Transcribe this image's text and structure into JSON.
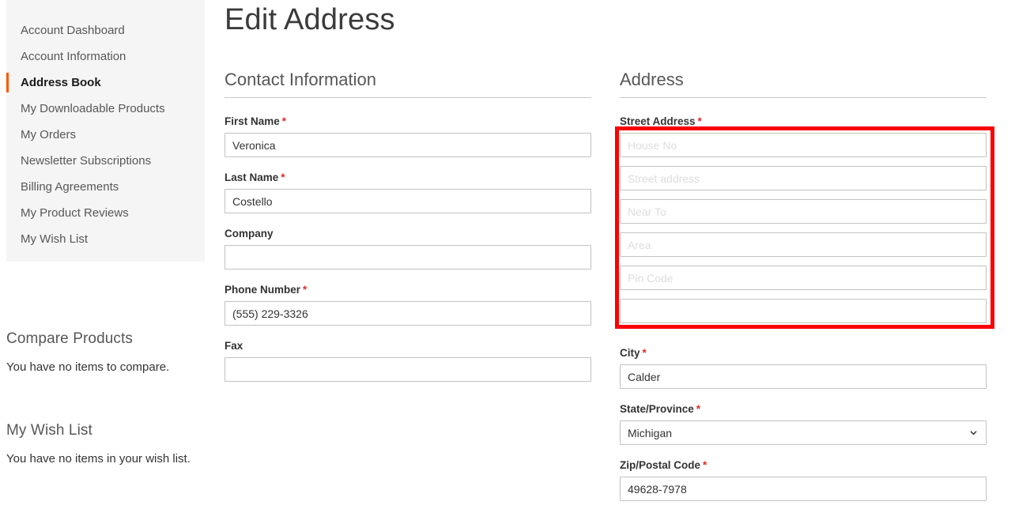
{
  "page": {
    "title": "Edit Address"
  },
  "sidebar": {
    "items": [
      {
        "label": "Account Dashboard",
        "active": false
      },
      {
        "label": "Account Information",
        "active": false
      },
      {
        "label": "Address Book",
        "active": true
      },
      {
        "label": "My Downloadable Products",
        "active": false
      },
      {
        "label": "My Orders",
        "active": false
      },
      {
        "label": "Newsletter Subscriptions",
        "active": false
      },
      {
        "label": "Billing Agreements",
        "active": false
      },
      {
        "label": "My Product Reviews",
        "active": false
      },
      {
        "label": "My Wish List",
        "active": false
      }
    ],
    "compare_block": {
      "title": "Compare Products",
      "empty_text": "You have no items to compare."
    },
    "wishlist_block": {
      "title": "My Wish List",
      "empty_text": "You have no items in your wish list."
    }
  },
  "contact_section": {
    "legend": "Contact Information",
    "fields": {
      "first_name": {
        "label": "First Name",
        "required_mark": "*",
        "value": "Veronica",
        "placeholder": ""
      },
      "last_name": {
        "label": "Last Name",
        "required_mark": "*",
        "value": "Costello",
        "placeholder": ""
      },
      "company": {
        "label": "Company",
        "required_mark": "",
        "value": "",
        "placeholder": ""
      },
      "phone": {
        "label": "Phone Number",
        "required_mark": "*",
        "value": "(555) 229-3326",
        "placeholder": ""
      },
      "fax": {
        "label": "Fax",
        "required_mark": "",
        "value": "",
        "placeholder": ""
      }
    }
  },
  "address_section": {
    "legend": "Address",
    "street": {
      "label": "Street Address",
      "required_mark": "*",
      "highlighted": true,
      "lines": [
        {
          "placeholder": "House No",
          "value": ""
        },
        {
          "placeholder": "Street address",
          "value": ""
        },
        {
          "placeholder": "Near To",
          "value": ""
        },
        {
          "placeholder": "Area",
          "value": ""
        },
        {
          "placeholder": "Pin Code",
          "value": ""
        },
        {
          "placeholder": "",
          "value": ""
        }
      ]
    },
    "fields": {
      "city": {
        "label": "City",
        "required_mark": "*",
        "value": "Calder",
        "placeholder": ""
      },
      "state": {
        "label": "State/Province",
        "required_mark": "*",
        "value": "Michigan",
        "icon": "chevron-down-icon"
      },
      "zip": {
        "label": "Zip/Postal Code",
        "required_mark": "*",
        "value": "49628-7978",
        "placeholder": ""
      }
    }
  },
  "colors": {
    "accent": "#ff5501",
    "highlight": "#fb0000",
    "required": "#e02b27",
    "sidebar_bg": "#f5f5f5",
    "input_border": "#c2c2c2"
  }
}
